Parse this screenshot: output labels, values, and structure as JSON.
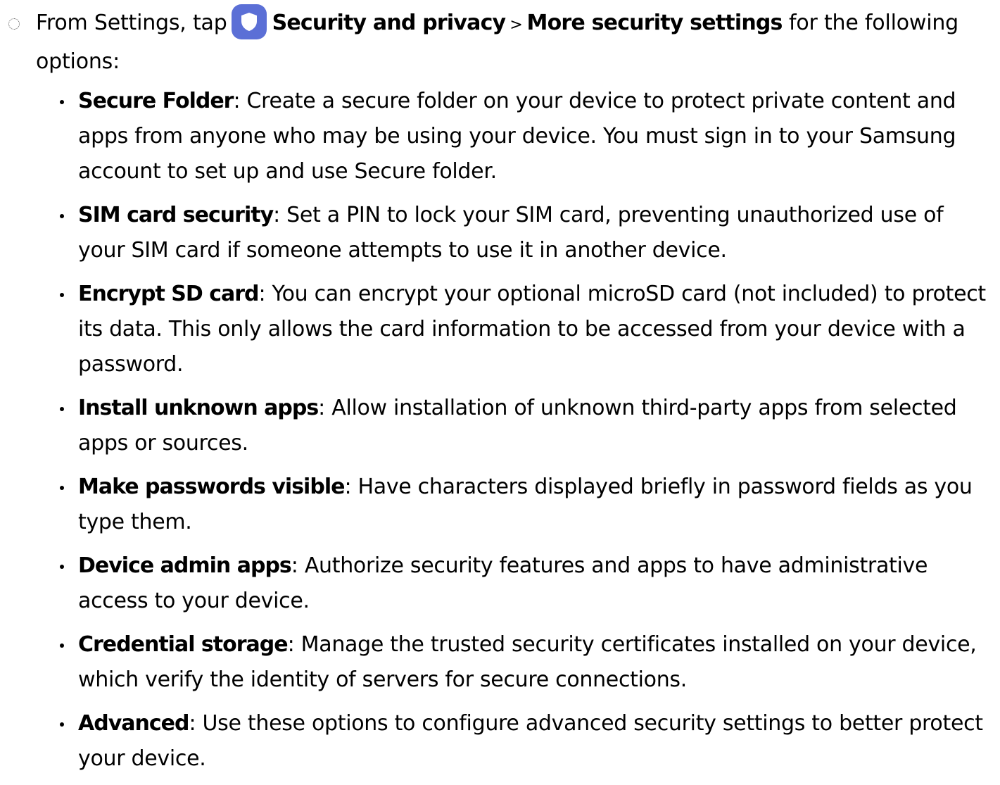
{
  "intro": {
    "prefix": "From Settings, tap",
    "icon": "shield-icon",
    "icon_color": "#5b6fd6",
    "link1": "Security and privacy",
    "separator": ">",
    "link2": "More security settings",
    "suffix": "for the following options:"
  },
  "options": [
    {
      "term": "Secure Folder",
      "desc": ": Create a secure folder on your device to protect private content and apps from anyone who may be using your device. You must sign in to your Samsung account to set up and use Secure folder."
    },
    {
      "term": "SIM card security",
      "desc": ": Set a PIN to lock your SIM card, preventing unauthorized use of your SIM card if someone attempts to use it in another device."
    },
    {
      "term": "Encrypt SD card",
      "desc": ": You can encrypt your optional microSD card (not included) to protect its data. This only allows the card information to be accessed from your device with a password."
    },
    {
      "term": "Install unknown apps",
      "desc": ": Allow installation of unknown third-party apps from selected apps or sources."
    },
    {
      "term": "Make passwords visible",
      "desc": ": Have characters displayed briefly in password fields as you type them."
    },
    {
      "term": "Device admin apps",
      "desc": ": Authorize security features and apps to have administrative access to your device."
    },
    {
      "term": "Credential storage",
      "desc": ": Manage the trusted security certificates installed on your device, which verify the identity of servers for secure connections."
    },
    {
      "term": "Advanced",
      "desc": ": Use these options to configure advanced security settings to better protect your device."
    }
  ]
}
